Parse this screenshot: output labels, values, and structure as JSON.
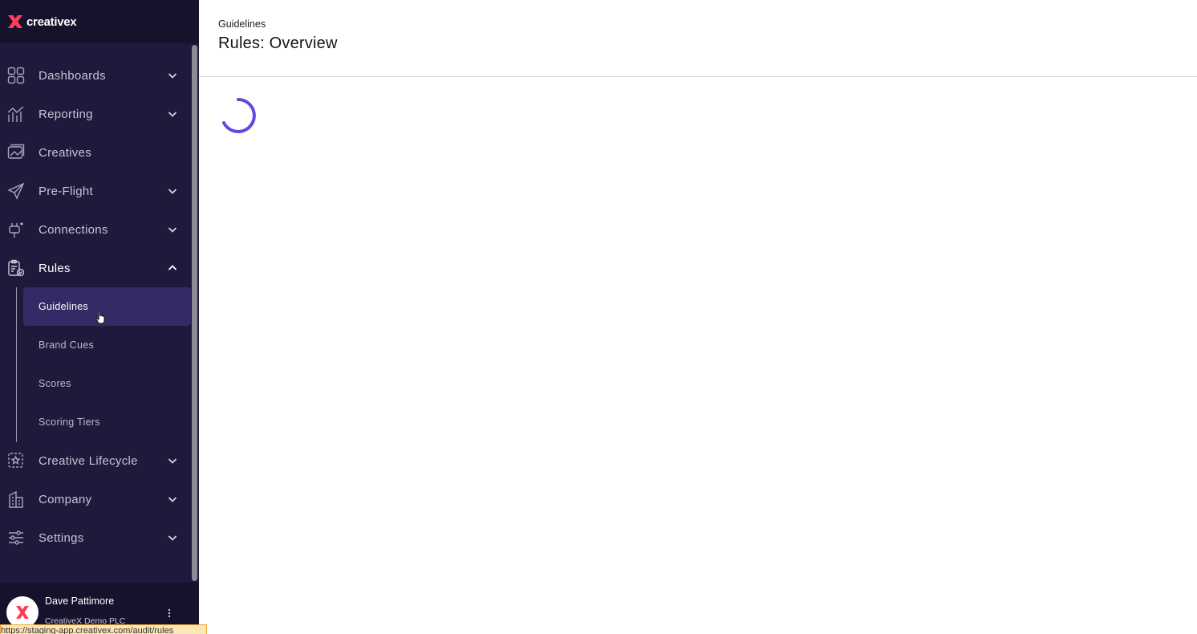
{
  "app": {
    "brand_name": "creativex",
    "brand_color": "#ff3d57"
  },
  "sidebar": {
    "items": [
      {
        "label": "Dashboards",
        "icon": "grid-icon",
        "has_chevron": true,
        "expanded": false
      },
      {
        "label": "Reporting",
        "icon": "chart-icon",
        "has_chevron": true,
        "expanded": false
      },
      {
        "label": "Creatives",
        "icon": "images-icon",
        "has_chevron": false,
        "expanded": false
      },
      {
        "label": "Pre-Flight",
        "icon": "paper-plane-icon",
        "has_chevron": true,
        "expanded": false
      },
      {
        "label": "Connections",
        "icon": "plug-icon",
        "has_chevron": true,
        "expanded": false
      },
      {
        "label": "Rules",
        "icon": "clipboard-check-icon",
        "has_chevron": true,
        "expanded": true
      },
      {
        "label": "Creative Lifecycle",
        "icon": "lifecycle-icon",
        "has_chevron": true,
        "expanded": false
      },
      {
        "label": "Company",
        "icon": "building-icon",
        "has_chevron": true,
        "expanded": false
      },
      {
        "label": "Settings",
        "icon": "sliders-icon",
        "has_chevron": true,
        "expanded": false
      }
    ],
    "rules_subitems": [
      {
        "label": "Guidelines",
        "active": true
      },
      {
        "label": "Brand Cues",
        "active": false
      },
      {
        "label": "Scores",
        "active": false
      },
      {
        "label": "Scoring Tiers",
        "active": false
      }
    ],
    "active_color": "#332b66"
  },
  "user": {
    "name": "Dave Pattimore",
    "company": "CreativeX Demo PLC"
  },
  "status_bar": {
    "url": "https://staging-app.creativex.com/audit/rules"
  },
  "header": {
    "breadcrumb": "Guidelines",
    "title": "Rules: Overview"
  },
  "loading": {
    "spinner_color": "#5b4be0"
  }
}
